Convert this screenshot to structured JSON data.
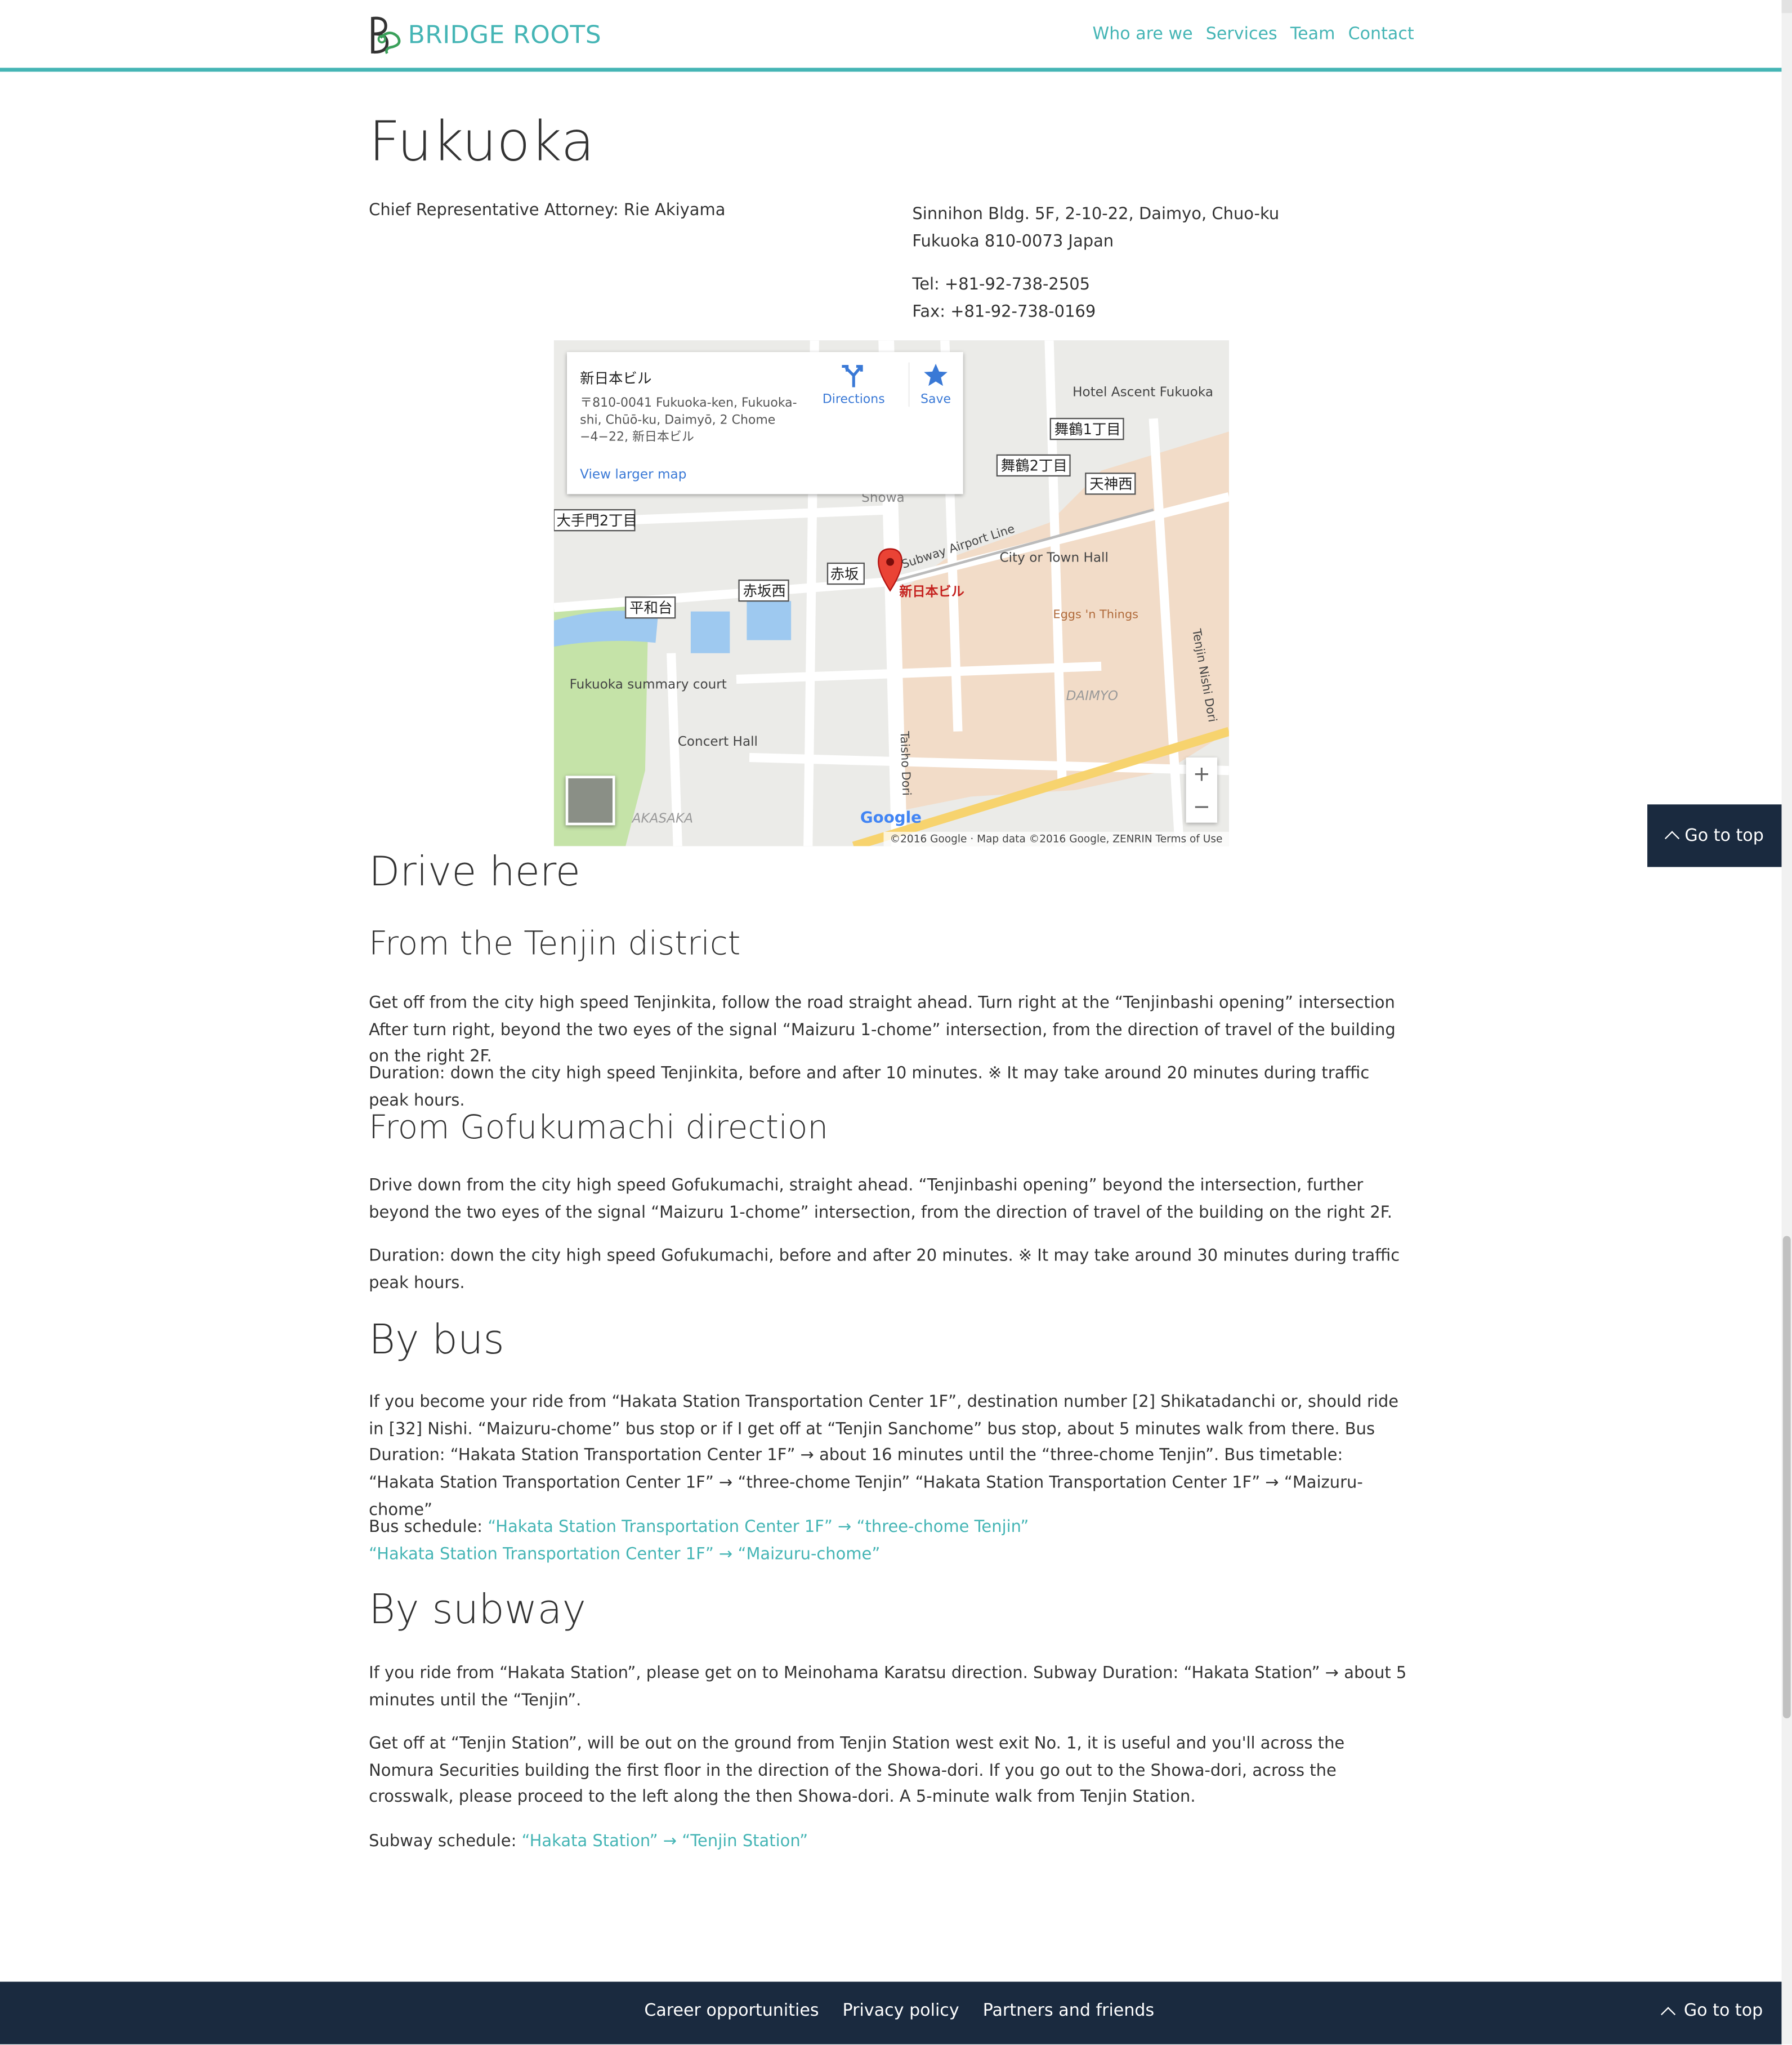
{
  "header": {
    "brand": "BRIDGE ROOTS",
    "nav": [
      "Who are we",
      "Services",
      "Team",
      "Contact"
    ]
  },
  "office": {
    "city": "Fukuoka",
    "attorney": "Chief Representative Attorney: Rie Akiyama",
    "address_line1": "Sinnihon Bldg. 5F, 2-10-22, Daimyo, Chuo-ku",
    "address_line2": "Fukuoka 810-0073 Japan",
    "tel": "Tel: +81-92-738-2505",
    "fax": "Fax: +81-92-738-0169"
  },
  "map": {
    "place_title": "新日本ビル",
    "place_address": "〒810-0041 Fukuoka-ken, Fukuoka-shi, Chūō-ku, Daimyō, 2 Chome −4−22, 新日本ビル",
    "directions_label": "Directions",
    "save_label": "Save",
    "larger_map": "View larger map",
    "pin_label": "新日本ビル",
    "labels": {
      "hotel": "Hotel Ascent Fukuoka",
      "city_hall": "City or Town Hall",
      "subway_line": "Subway Airport Line",
      "eggs": "Eggs 'n Things",
      "daimyo": "DAIMYO",
      "summary_court": "Fukuoka summary court",
      "concert_hall": "Concert Hall",
      "akasaka": "AKASAKA",
      "taisho": "Taisho Dori",
      "tenjin_nishi": "Tenjin Nishi Dori",
      "showa": "Showa",
      "akasaka_station": "赤坂",
      "heiwadai": "平和台",
      "akasakanishi": "赤坂西",
      "otemon": "大手門2丁目",
      "tenjinnishi_jp": "天神西",
      "maizuru1": "舞鶴1丁目",
      "maizuru2": "舞鶴2丁目"
    },
    "zoom_in": "+",
    "zoom_out": "−",
    "attribution": "©2016 Google · Map data ©2016 Google, ZENRIN   Terms of Use",
    "google": "Google"
  },
  "drive": {
    "heading": "Drive here",
    "tenjin_heading": "From the Tenjin district",
    "tenjin_p1": "Get off from the city high speed Tenjinkita, follow the road straight ahead. Turn right at the “Tenjinbashi opening” intersection After turn right, beyond the two eyes of the signal “Maizuru 1-chome” intersection, from the direction of travel of the building on the right 2F.",
    "tenjin_p2": "Duration: down the city high speed Tenjinkita, before and after 10 minutes. ※ It may take around 20 minutes during traffic peak hours.",
    "gofuku_heading": "From Gofukumachi direction",
    "gofuku_p1": "Drive down from the city high speed Gofukumachi, straight ahead. “Tenjinbashi opening” beyond the intersection, further beyond the two eyes of the signal “Maizuru 1-chome” intersection, from the direction of travel of the building on the right 2F.",
    "gofuku_p2": "Duration: down the city high speed Gofukumachi, before and after 20 minutes. ※ It may take around 30 minutes during traffic peak hours."
  },
  "bus": {
    "heading": "By bus",
    "p1": "If you become your ride from “Hakata Station Transportation Center 1F”, destination number [2] Shikatadanchi or, should ride in [32] Nishi. “Maizuru-chome” bus stop or if I get off at “Tenjin Sanchome” bus stop, about 5 minutes walk from there. Bus Duration: “Hakata Station Transportation Center 1F” → about 16 minutes until the “three-chome Tenjin”. Bus timetable: “Hakata Station Transportation Center 1F” → “three-chome Tenjin” “Hakata Station Transportation Center 1F” → “Maizuru-chome”",
    "schedule_label": "Bus schedule: ",
    "schedule_link1": "“Hakata Station Transportation Center 1F” → “three-chome Tenjin”",
    "schedule_link2": "“Hakata Station Transportation Center 1F” → “Maizuru-chome”"
  },
  "subway": {
    "heading": "By subway",
    "p1": "If you ride from “Hakata Station”, please get on to Meinohama Karatsu direction. Subway Duration: “Hakata Station” → about 5 minutes until the “Tenjin”.",
    "p2": "Get off at “Tenjin Station”, will be out on the ground from Tenjin Station west exit No. 1, it is useful and you'll across the Nomura Securities building the first floor in the direction of the Showa-dori. If you go out to the Showa-dori, across the crosswalk, please proceed to the left along the then Showa-dori. A 5-minute walk from Tenjin Station.",
    "schedule_label": "Subway schedule: ",
    "schedule_link": "“Hakata Station” → “Tenjin Station”"
  },
  "go_to_top": "Go to top",
  "footer": {
    "links": [
      "Career opportunities",
      "Privacy policy",
      "Partners and friends"
    ],
    "go_to_top": "Go to top"
  },
  "colors": {
    "accent": "#45b5b5",
    "navy": "#1a2a3f",
    "text": "#333333",
    "link_blue": "#3a79d6"
  }
}
